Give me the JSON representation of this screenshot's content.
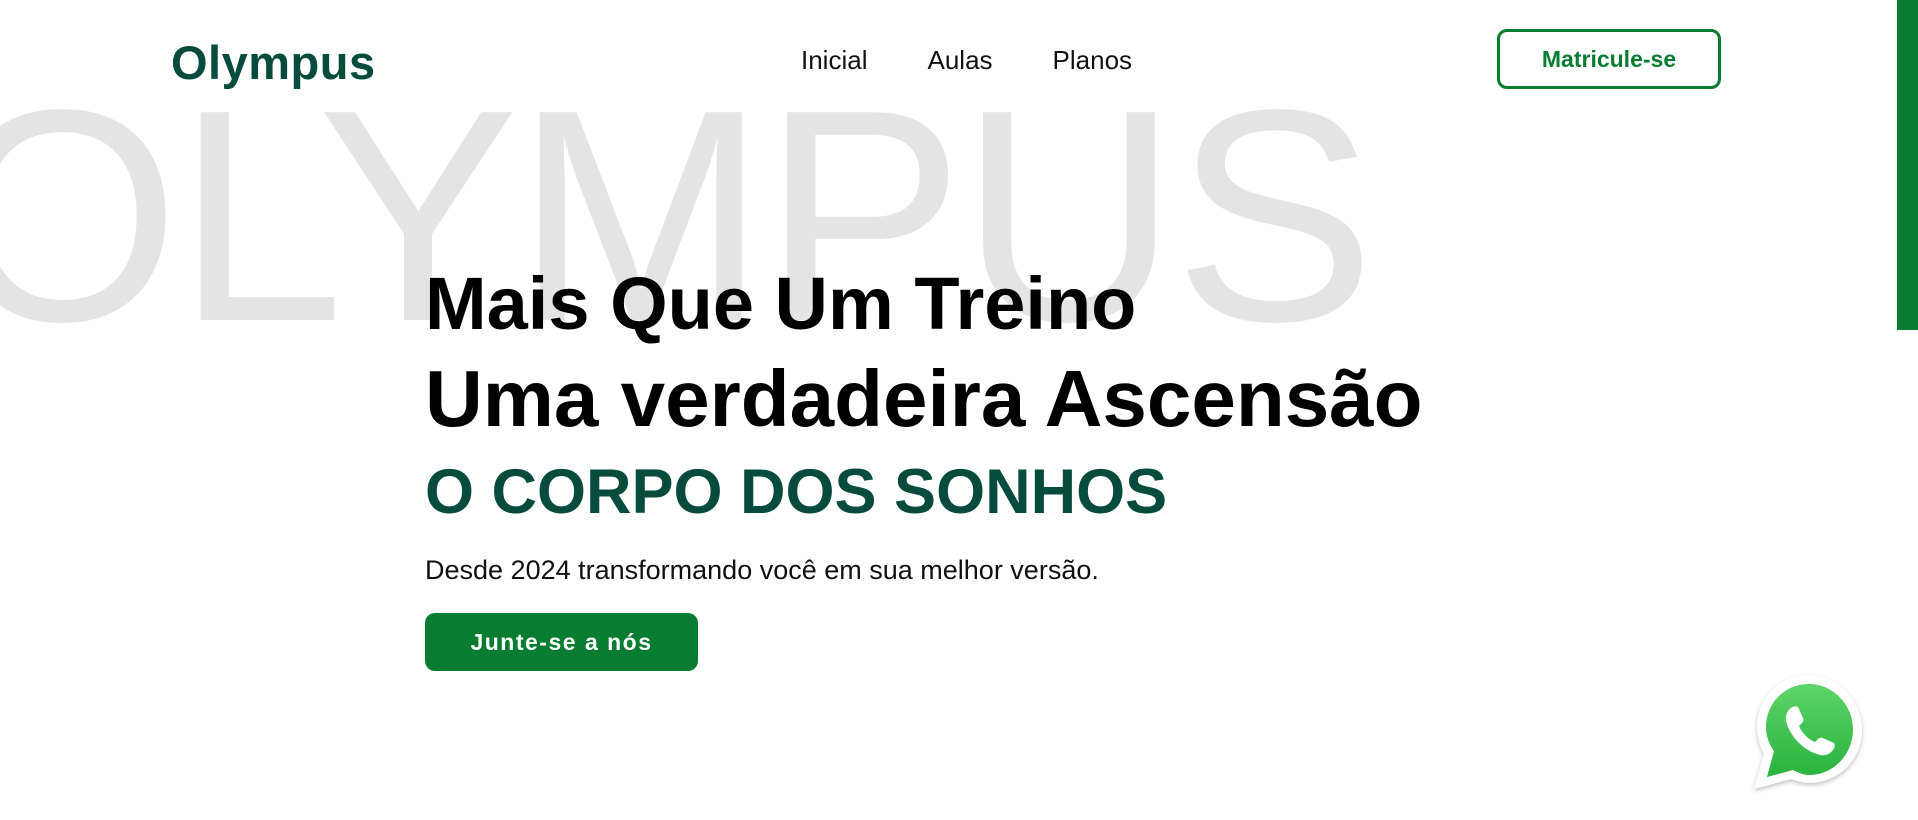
{
  "brand": {
    "logo": "Olympus",
    "watermark": "OLYMPUS"
  },
  "nav": {
    "items": [
      {
        "label": "Inicial"
      },
      {
        "label": "Aulas"
      },
      {
        "label": "Planos"
      }
    ],
    "cta_label": "Matricule-se"
  },
  "hero": {
    "headline_line1": "Mais Que Um Treino",
    "headline_line2": "Uma verdadeira Ascensão",
    "tagline": "O CORPO DOS SONHOS",
    "subtitle": "Desde 2024 transformando você em sua melhor versão.",
    "cta_label": "Junte-se a nós"
  },
  "floating": {
    "whatsapp_icon": "whatsapp-icon"
  },
  "colors": {
    "brand_dark_green": "#064b3b",
    "brand_green": "#087d31",
    "watermark_gray": "#e4e4e4",
    "whatsapp_green": "#3fc350"
  }
}
